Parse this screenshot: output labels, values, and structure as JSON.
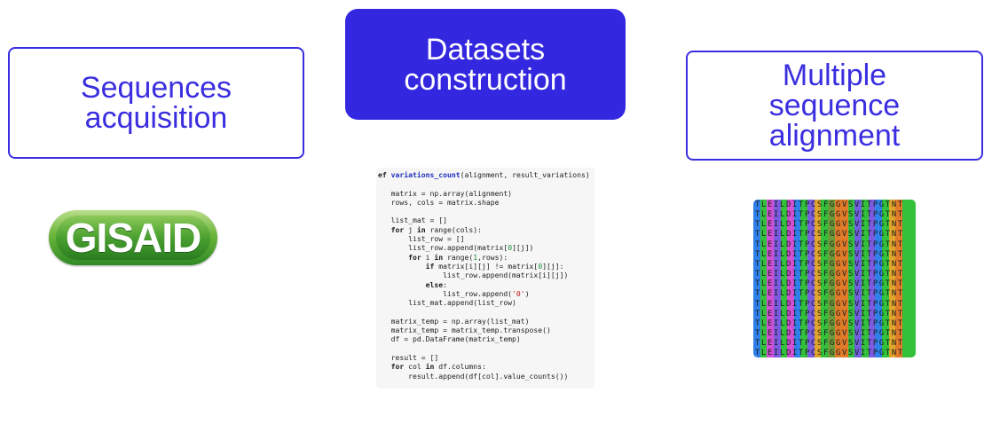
{
  "boxes": {
    "sequences_acquisition": "Sequences\nacquisition",
    "datasets_construction": "Datasets\nconstruction",
    "multiple_sequence_alignment": "Multiple\nsequence\nalignment"
  },
  "gisaid_logo_text": "GISAID",
  "code": {
    "lines": [
      "ef variations_count(alignment, result_variations)",
      "",
      "   matrix = np.array(alignment)",
      "   rows, cols = matrix.shape",
      "",
      "   list_mat = []",
      "   for j in range(cols):",
      "       list_row = []",
      "       list_row.append(matrix[0][j])",
      "       for i in range(1,rows):",
      "           if matrix[i][j] != matrix[0][j]:",
      "               list_row.append(matrix[i][j])",
      "           else:",
      "               list_row.append('0')",
      "       list_mat.append(list_row)",
      "",
      "   matrix_temp = np.array(list_mat)",
      "   matrix_temp = matrix_temp.transpose()",
      "   df = pd.DataFrame(matrix_temp)",
      "",
      "   result = []",
      "   for col in df.columns:",
      "       result.append(df[col].value_counts())"
    ]
  },
  "alignment": {
    "sequence": "TLEILDITPCSFGGVSVITPGTNT",
    "rows": 16,
    "column_colors": [
      "#2f80e8",
      "#33c13c",
      "#d24fd6",
      "#7b5ce0",
      "#33c13c",
      "#d24fd6",
      "#2f80e8",
      "#33c13c",
      "#7b5ce0",
      "#e0a52a",
      "#33c13c",
      "#6f9a3a",
      "#e07b2a",
      "#e07b2a",
      "#33c13c",
      "#6f60e0",
      "#33c13c",
      "#7b5ce0",
      "#2f80e8",
      "#33c13c",
      "#e0a52a",
      "#e07b2a",
      "#33c13c",
      "#33c13c"
    ]
  }
}
